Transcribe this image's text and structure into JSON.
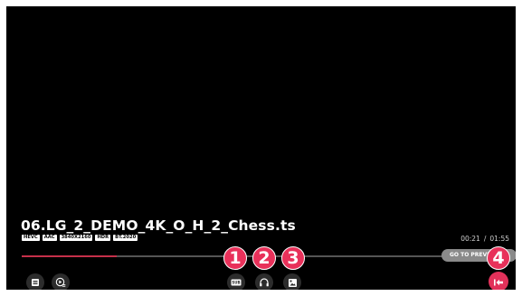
{
  "video": {
    "title": "06.LG_2_DEMO_4K_O_H_2_Chess.ts",
    "badges": [
      "HEVC",
      "AAC",
      "3840X2160",
      "HDR",
      "BT.2020"
    ]
  },
  "playback": {
    "current_time": "00:21",
    "separator": "/",
    "total_time": "01:55",
    "progress_fraction": 0.195
  },
  "controls": {
    "left": [
      {
        "name": "playlist-button",
        "icon": "list-icon"
      },
      {
        "name": "play-settings-button",
        "icon": "play-list-icon"
      }
    ],
    "center": [
      {
        "name": "subtitle-button",
        "icon": "subtitle-icon",
        "label": "SUB"
      },
      {
        "name": "audio-track-button",
        "icon": "headphones-icon"
      },
      {
        "name": "scene-button",
        "icon": "picture-icon"
      }
    ],
    "go_to_previous_label": "GO TO PREVIOUS"
  },
  "markers": [
    "1",
    "2",
    "3",
    "4"
  ],
  "colors": {
    "accent": "#e2315a",
    "progress": "#c6304a",
    "background": "#000000"
  }
}
